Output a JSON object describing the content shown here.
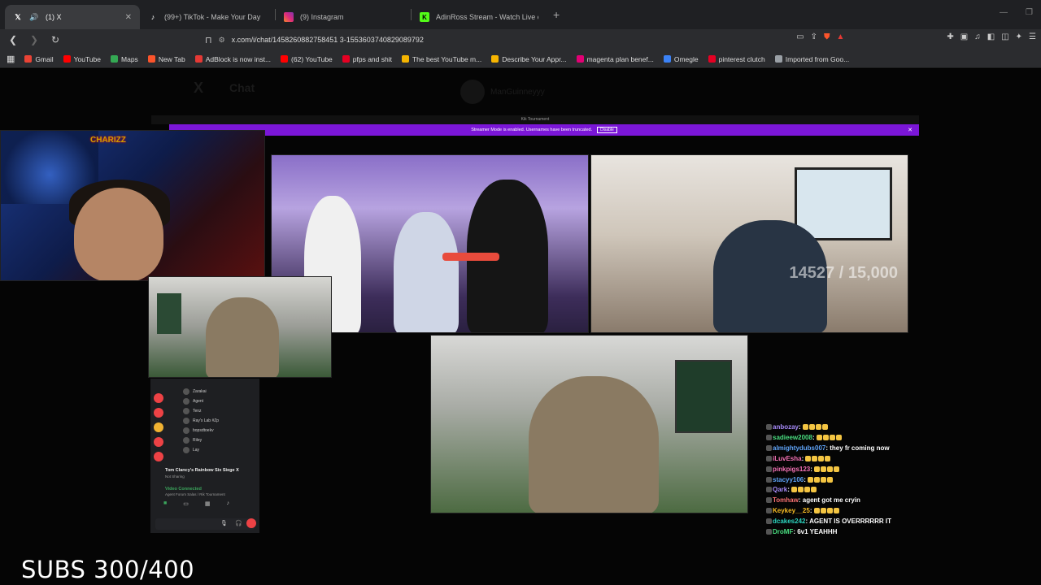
{
  "tabs": [
    {
      "title": "(1) X",
      "icon": "x-icon",
      "active": true
    },
    {
      "title": "(99+) TikTok - Make Your Day",
      "icon": "tiktok-icon",
      "active": false
    },
    {
      "title": "(9) Instagram",
      "icon": "instagram-icon",
      "active": false
    },
    {
      "title": "AdinRoss Stream - Watch Live on Ki",
      "icon": "kick-icon",
      "active": false
    }
  ],
  "url": "x.com/i/chat/1458260882758451 3-1553603740829089792",
  "bookmarks": [
    {
      "label": "Gmail",
      "color": "#ea4335"
    },
    {
      "label": "YouTube",
      "color": "#ff0000"
    },
    {
      "label": "Maps",
      "color": "#34a853"
    },
    {
      "label": "New Tab",
      "color": "#fb542b"
    },
    {
      "label": "AdBlock is now inst...",
      "color": "#e53935"
    },
    {
      "label": "(62) YouTube",
      "color": "#ff0000"
    },
    {
      "label": "pfps and shit",
      "color": "#e60023"
    },
    {
      "label": "The best YouTube m...",
      "color": "#f4b400"
    },
    {
      "label": "Describe Your Appr...",
      "color": "#f7b500"
    },
    {
      "label": "magenta plan benef...",
      "color": "#e20074"
    },
    {
      "label": "Omegle",
      "color": "#3b82f6"
    },
    {
      "label": "pinterest clutch",
      "color": "#e60023"
    },
    {
      "label": "Imported from Goo...",
      "color": "#9aa0a6"
    }
  ],
  "xpage": {
    "logo": "X",
    "title": "Chat",
    "conversation_name": "ManGuinneyyy"
  },
  "stream_window": {
    "title": "Kik Tournament",
    "banner_text": "Streamer Mode is enabled. Usernames have been truncated.",
    "banner_button": "Disable"
  },
  "counter_overlay": "14527 / 15,000",
  "webcam_label": "CHARIZZ",
  "discord": {
    "users": [
      "Zarakai",
      "Agent",
      "Tenz",
      "Ray's Lab #Zp",
      "bopsdtoekv",
      "Riley",
      "Lay"
    ],
    "game": "Tom Clancy's Rainbow Six Siege X",
    "game_sub": "Not Sharing",
    "vc_status": "Video Connected",
    "vc_sub": "Agent Forum Salas / Rik Tournament"
  },
  "chat": [
    {
      "user": "anbozay",
      "msg": "",
      "color": "#a78bfa"
    },
    {
      "user": "sadieew2008",
      "msg": "",
      "color": "#4ade80"
    },
    {
      "user": "almightydubs007",
      "msg": "they fr coming now",
      "color": "#60a5fa"
    },
    {
      "user": "iLuvEsha",
      "msg": "",
      "color": "#f472b6"
    },
    {
      "user": "pinkpigs123",
      "msg": "",
      "color": "#f472b6"
    },
    {
      "user": "stacyy106",
      "msg": "",
      "color": "#60a5fa"
    },
    {
      "user": "Qark",
      "msg": "",
      "color": "#a78bfa"
    },
    {
      "user": "Tomhaw",
      "msg": "agent got me cryin",
      "color": "#f87171"
    },
    {
      "user": "Keykey__25",
      "msg": "",
      "color": "#fbbf24"
    },
    {
      "user": "dcakes242",
      "msg": "AGENT IS OVERRRRRR IT",
      "color": "#2dd4bf"
    },
    {
      "user": "DroMF",
      "msg": "6v1 YEAHHH",
      "color": "#4ade80"
    }
  ],
  "subs_text": "SUBS 300/400"
}
